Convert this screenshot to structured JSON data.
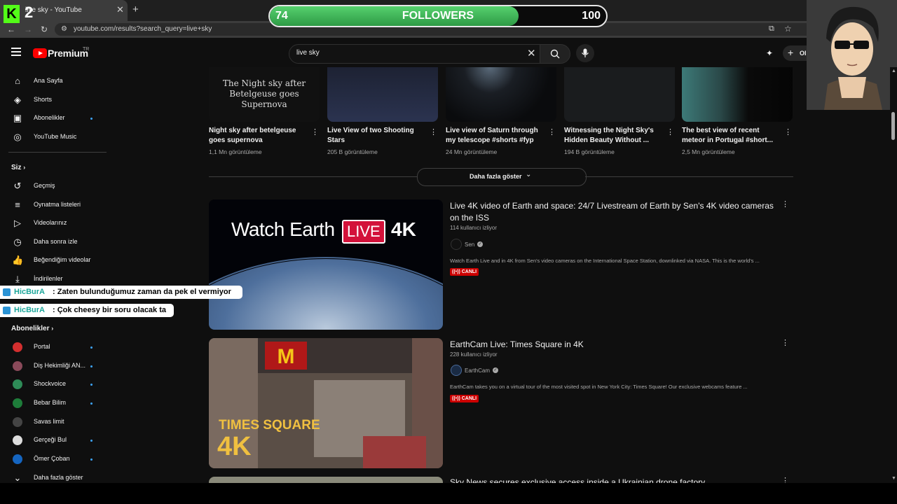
{
  "browser": {
    "tab_title": "live sky - YouTube",
    "url": "youtube.com/results?search_query=live+sky"
  },
  "stream_overlay": {
    "channel_initial": "K",
    "channel_number": "2",
    "followers_current": "74",
    "followers_label": "FOLLOWERS",
    "followers_goal": "100",
    "followers_progress": 0.74,
    "chat": [
      {
        "user": "HicBurA",
        "text": ": Zaten bulunduğumuz zaman da pek el vermiyor"
      },
      {
        "user": "HicBurA",
        "text": ": Çok cheesy bir soru olacak ta"
      }
    ]
  },
  "header": {
    "brand": "Premium",
    "region": "TR",
    "search_value": "live sky",
    "create_label": "Oluştur"
  },
  "sidebar": {
    "main": [
      {
        "label": "Ana Sayfa",
        "icon": "home-icon",
        "glyph": "⌂"
      },
      {
        "label": "Shorts",
        "icon": "shorts-icon",
        "glyph": "◈"
      },
      {
        "label": "Abonelikler",
        "icon": "subscriptions-icon",
        "glyph": "▣"
      },
      {
        "label": "YouTube Music",
        "icon": "music-icon",
        "glyph": "◎"
      }
    ],
    "you_heading": "Siz",
    "you": [
      {
        "label": "Geçmiş",
        "icon": "history-icon",
        "glyph": "↺"
      },
      {
        "label": "Oynatma listeleri",
        "icon": "playlists-icon",
        "glyph": "≡"
      },
      {
        "label": "Videolarınız",
        "icon": "your-videos-icon",
        "glyph": "▷"
      },
      {
        "label": "Daha sonra izle",
        "icon": "watch-later-icon",
        "glyph": "◷"
      },
      {
        "label": "Beğendiğim videolar",
        "icon": "like-icon",
        "glyph": "👍"
      },
      {
        "label": "İndirilenler",
        "icon": "download-icon",
        "glyph": "⤓"
      }
    ],
    "subs_heading": "Abonelikler",
    "subs": [
      {
        "label": "Portal",
        "color": "#d32f2f"
      },
      {
        "label": "Diş Hekimliği AN...",
        "color": "#8a4a5a"
      },
      {
        "label": "Shockvoice",
        "color": "#2e8b57"
      },
      {
        "label": "Bebar Bilim",
        "color": "#1e7d3a"
      },
      {
        "label": "Savas limit",
        "color": "#444444"
      },
      {
        "label": "Gerçeği Bul",
        "color": "#dddddd"
      },
      {
        "label": "Ömer Çoban",
        "color": "#1565c0"
      }
    ],
    "more_label": "Daha fazla göster"
  },
  "shorts": [
    {
      "title": "Night sky after betelgeuse goes supernova",
      "views": "1,1 Mn görüntüleme",
      "overlay": "The Night sky after Betelgeuse goes Supernova",
      "bg": "#111111"
    },
    {
      "title": "Live View of two Shooting Stars",
      "views": "205 B görüntüleme",
      "overlay": "",
      "bg": "#1d2233"
    },
    {
      "title": "Live view of Saturn through my telescope #shorts #fyp",
      "views": "24 Mn görüntüleme",
      "overlay": "",
      "bg": "#0e1014"
    },
    {
      "title": "Witnessing the Night Sky's Hidden Beauty Without ...",
      "views": "194 B görüntüleme",
      "overlay": "",
      "bg": "#1a1c1e"
    },
    {
      "title": "The best view of recent meteor in Portugal #short...",
      "views": "2,5 Mn görüntüleme",
      "overlay": "",
      "bg": "#2a4a4a"
    }
  ],
  "show_more_label": "Daha fazla göster",
  "results": [
    {
      "title": "Live 4K video of Earth and space: 24/7 Livestream of Earth by Sen's 4K video cameras on the ISS",
      "meta": "114 kullanıcı izliyor",
      "channel": "Sen",
      "desc": "Watch Earth Live and in 4K from Sen's video cameras on the International Space Station, downlinked via NASA. This is the world's ...",
      "badge": "CANLI",
      "thumb_text_a": "Watch Earth",
      "thumb_text_b": "LIVE",
      "thumb_text_c": "4K"
    },
    {
      "title": "EarthCam Live: Times Square in 4K",
      "meta": "228 kullanıcı izliyor",
      "channel": "EarthCam",
      "desc": "EarthCam takes you on a virtual tour of the most visited spot in New York City: Times Square! Our exclusive webcams feature ...",
      "badge": "CANLI",
      "thumb_text_a": "TIMES SQUARE",
      "thumb_text_b": "4K"
    },
    {
      "title": "Sky News secures exclusive access inside a Ukrainian drone factory"
    }
  ]
}
